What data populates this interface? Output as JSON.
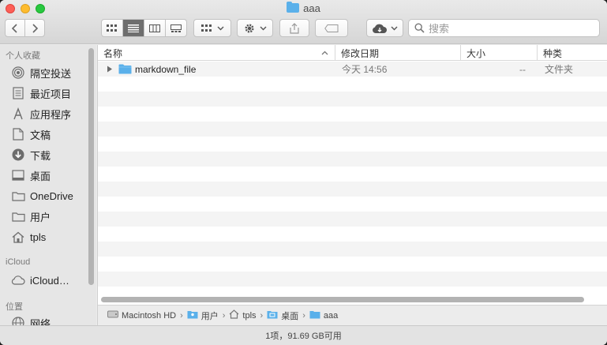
{
  "window": {
    "title": "aaa"
  },
  "toolbar": {
    "search_placeholder": "搜索"
  },
  "sidebar": {
    "sections": [
      {
        "heading": "个人收藏"
      },
      {
        "heading": "iCloud"
      },
      {
        "heading": "位置"
      }
    ],
    "favorites": [
      {
        "label": "隔空投送",
        "icon": "airdrop-icon"
      },
      {
        "label": "最近项目",
        "icon": "recents-icon"
      },
      {
        "label": "应用程序",
        "icon": "applications-icon"
      },
      {
        "label": "文稿",
        "icon": "documents-icon"
      },
      {
        "label": "下载",
        "icon": "downloads-icon"
      },
      {
        "label": "桌面",
        "icon": "desktop-icon"
      },
      {
        "label": "OneDrive",
        "icon": "folder-icon"
      },
      {
        "label": "用户",
        "icon": "folder-icon"
      },
      {
        "label": "tpls",
        "icon": "home-icon"
      }
    ],
    "icloud": [
      {
        "label": "iCloud…",
        "icon": "cloud-icon"
      }
    ],
    "locations": [
      {
        "label": "网络",
        "icon": "network-icon"
      }
    ]
  },
  "list": {
    "columns": {
      "name": "名称",
      "modified": "修改日期",
      "size": "大小",
      "kind": "种类"
    },
    "rows": [
      {
        "name": "markdown_file",
        "modified": "今天 14:56",
        "size": "--",
        "kind": "文件夹"
      }
    ]
  },
  "pathbar": {
    "items": [
      {
        "label": "Macintosh HD",
        "icon": "harddisk-icon"
      },
      {
        "label": "用户",
        "icon": "users-folder-icon"
      },
      {
        "label": "tpls",
        "icon": "home-icon"
      },
      {
        "label": "桌面",
        "icon": "desktop-folder-icon"
      },
      {
        "label": "aaa",
        "icon": "folder-icon"
      }
    ]
  },
  "status": {
    "text": "1项，91.69 GB可用"
  },
  "colors": {
    "folder": "#5ab0ea",
    "active_segment": "#6e6e6e"
  }
}
